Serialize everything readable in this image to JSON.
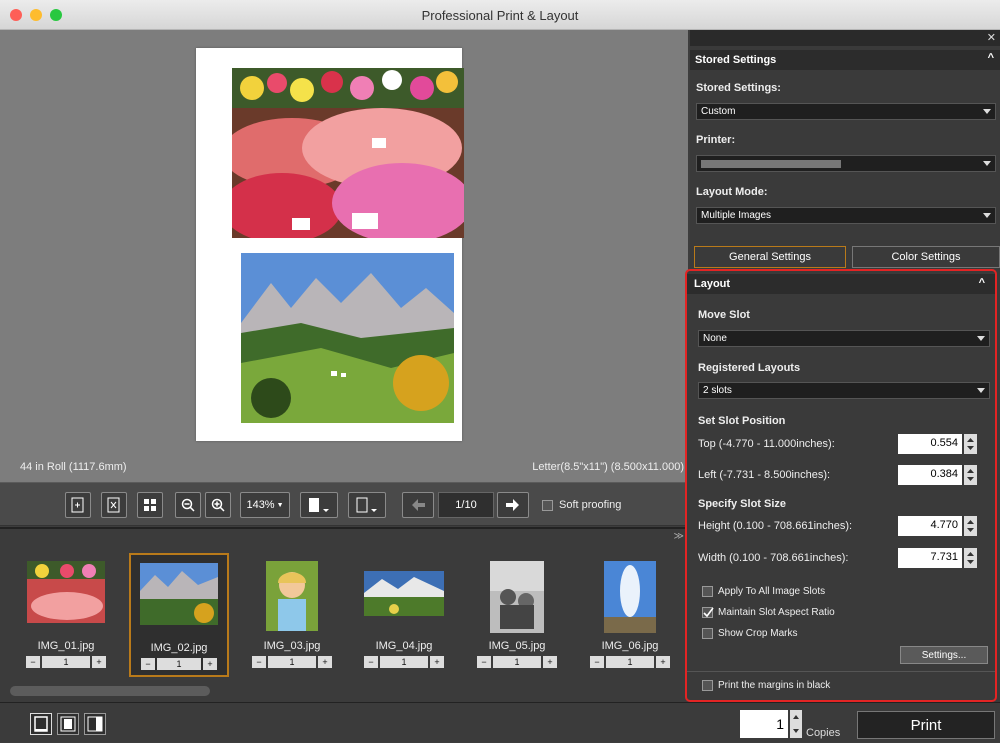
{
  "window": {
    "title": "Professional Print & Layout"
  },
  "preview": {
    "media_info": "44 in Roll (1117.6mm)",
    "paper_info": "Letter(8.5\"x11\") (8.500x11.000)"
  },
  "toolbar": {
    "zoom": "143%",
    "page": "1/10",
    "soft_proofing": "Soft proofing"
  },
  "thumbnails": [
    {
      "name": "IMG_01.jpg",
      "count": "1"
    },
    {
      "name": "IMG_02.jpg",
      "count": "1",
      "selected": true
    },
    {
      "name": "IMG_03.jpg",
      "count": "1"
    },
    {
      "name": "IMG_04.jpg",
      "count": "1"
    },
    {
      "name": "IMG_05.jpg",
      "count": "1"
    },
    {
      "name": "IMG_06.jpg",
      "count": "1"
    }
  ],
  "stored": {
    "header": "Stored Settings",
    "stored_label": "Stored Settings:",
    "stored_value": "Custom",
    "printer_label": "Printer:",
    "layout_mode_label": "Layout Mode:",
    "layout_mode_value": "Multiple Images"
  },
  "tabs": {
    "general": "General Settings",
    "color": "Color Settings"
  },
  "layout": {
    "header": "Layout",
    "move_slot_label": "Move Slot",
    "move_slot_value": "None",
    "registered_label": "Registered Layouts",
    "registered_value": "2 slots",
    "slot_position_label": "Set Slot Position",
    "top_label": "Top (-4.770 - 11.000inches):",
    "top_value": "0.554",
    "left_label": "Left (-7.731 - 8.500inches):",
    "left_value": "0.384",
    "slot_size_label": "Specify Slot Size",
    "height_label": "Height (0.100 - 708.661inches):",
    "height_value": "4.770",
    "width_label": "Width (0.100 - 708.661inches):",
    "width_value": "7.731",
    "apply_all": "Apply To All Image Slots",
    "maintain_ratio": "Maintain Slot Aspect Ratio",
    "show_crop": "Show Crop Marks",
    "settings_button": "Settings...",
    "print_margins": "Print the margins in black"
  },
  "bottom": {
    "copies_value": "1",
    "copies_label": "Copies",
    "print_label": "Print"
  },
  "colors": {
    "highlight": "#e32424",
    "selection": "#b97a1a"
  }
}
